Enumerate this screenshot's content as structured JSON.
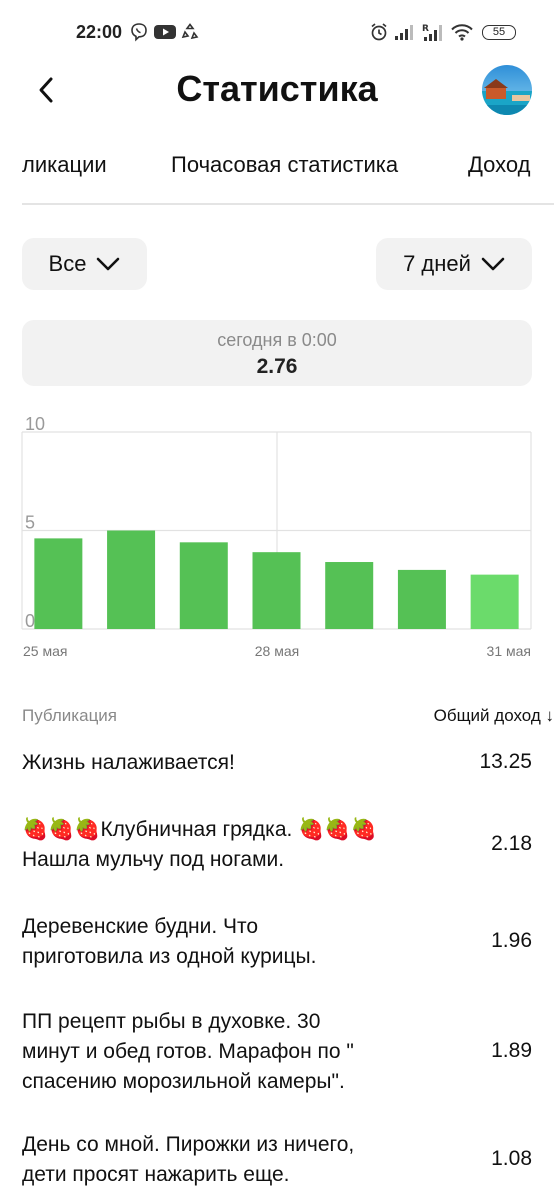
{
  "status_bar": {
    "time": "22:00",
    "battery": "55",
    "icons": [
      "viber-icon",
      "youtube-icon",
      "sync-icon",
      "alarm-icon",
      "signal-icon",
      "signal-roaming-icon",
      "wifi-icon",
      "battery-icon"
    ]
  },
  "header": {
    "title": "Статистика",
    "back_icon": "chevron-left-icon"
  },
  "tabs": [
    {
      "label": "ликации"
    },
    {
      "label": "Почасовая статистика"
    },
    {
      "label": "Доход"
    }
  ],
  "filters": {
    "type": {
      "label": "Все",
      "icon": "chevron-down-icon"
    },
    "period": {
      "label": "7 дней",
      "icon": "chevron-down-icon"
    }
  },
  "tooltip": {
    "label": "сегодня в 0:00",
    "value": "2.76"
  },
  "chart_data": {
    "type": "bar",
    "categories": [
      "25 мая",
      "26 мая",
      "27 мая",
      "28 мая",
      "29 мая",
      "30 мая",
      "31 мая"
    ],
    "x_tick_labels": [
      "25 мая",
      "28 мая",
      "31 мая"
    ],
    "values": [
      4.6,
      5.0,
      4.4,
      3.9,
      3.4,
      3.0,
      2.76
    ],
    "yticks": [
      "10",
      "5",
      "0"
    ],
    "ylim": [
      0,
      10
    ],
    "grid": true,
    "bar_color": "#55c155",
    "highlight_color": "#6bdb6b"
  },
  "table": {
    "col_publication": "Публикация",
    "col_income": "Общий доход ↓",
    "rows": [
      {
        "lines": [
          "Жизнь налаживается!"
        ],
        "value": "13.25"
      },
      {
        "lines": [
          "🍓🍓🍓Клубничная грядка. 🍓🍓🍓",
          "Нашла мульчу под ногами."
        ],
        "value": "2.18"
      },
      {
        "lines": [
          "Деревенские будни. Что",
          "приготовила из одной курицы."
        ],
        "value": "1.96"
      },
      {
        "lines": [
          "ПП рецепт рыбы в духовке. 30",
          "минут и обед готов. Марафон по \"",
          "спасению морозильной камеры\"."
        ],
        "value": "1.89"
      },
      {
        "lines": [
          "День со мной. Пирожки из ничего,",
          "дети просят нажарить еще."
        ],
        "value": "1.08"
      }
    ]
  }
}
